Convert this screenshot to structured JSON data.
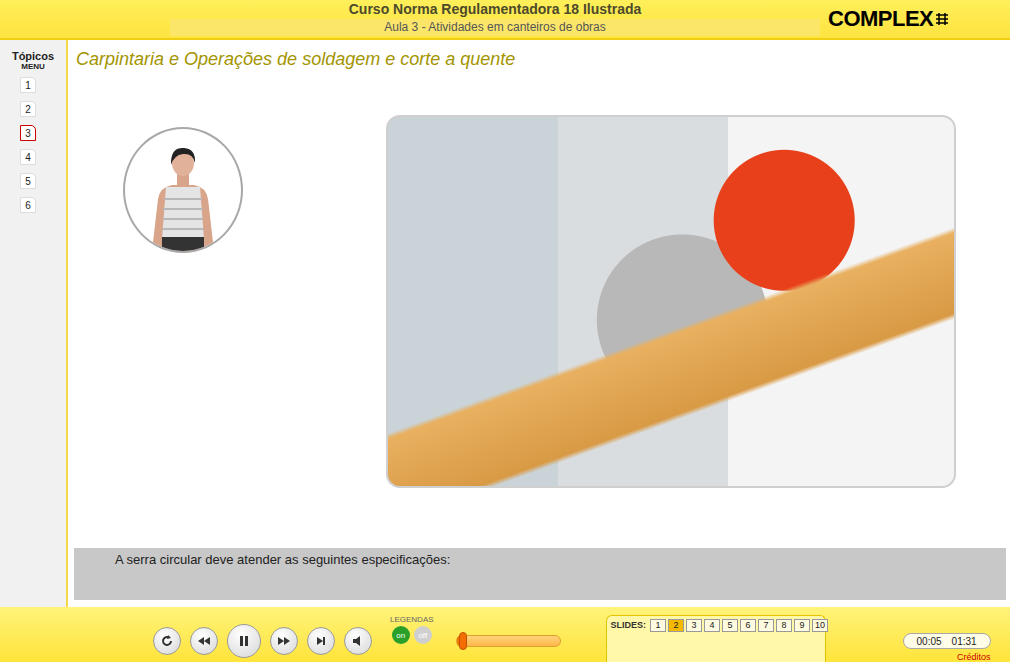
{
  "header": {
    "title": "Curso Norma Regulamentadora 18 Ilustrada",
    "subtitle": "Aula 3 - Atividades em canteiros de obras",
    "logo": "COMPLEX"
  },
  "sidebar": {
    "title": "Tópicos",
    "subtitle": "MENU",
    "items": [
      {
        "label": "1",
        "selected": false
      },
      {
        "label": "2",
        "selected": false
      },
      {
        "label": "3",
        "selected": true
      },
      {
        "label": "4",
        "selected": false
      },
      {
        "label": "5",
        "selected": false
      },
      {
        "label": "6",
        "selected": false
      }
    ]
  },
  "slide": {
    "title": "Carpintaria e Operações de soldagem e corte a quente",
    "caption": "A serra circular deve atender as seguintes especificações:"
  },
  "player": {
    "playing": true
  },
  "subtitles": {
    "label": "LEGENDAS",
    "on_label": "on",
    "off_label": "off",
    "on": true
  },
  "progress": {
    "level": 0.06
  },
  "slides": {
    "label": "SLIDES:",
    "items": [
      {
        "label": "1",
        "selected": false
      },
      {
        "label": "2",
        "selected": true
      },
      {
        "label": "3",
        "selected": false
      },
      {
        "label": "4",
        "selected": false
      },
      {
        "label": "5",
        "selected": false
      },
      {
        "label": "6",
        "selected": false
      },
      {
        "label": "7",
        "selected": false
      },
      {
        "label": "8",
        "selected": false
      },
      {
        "label": "9",
        "selected": false
      },
      {
        "label": "10",
        "selected": false
      }
    ]
  },
  "time": {
    "elapsed": "00:05",
    "total": "01:31"
  },
  "credits": "Créditos"
}
